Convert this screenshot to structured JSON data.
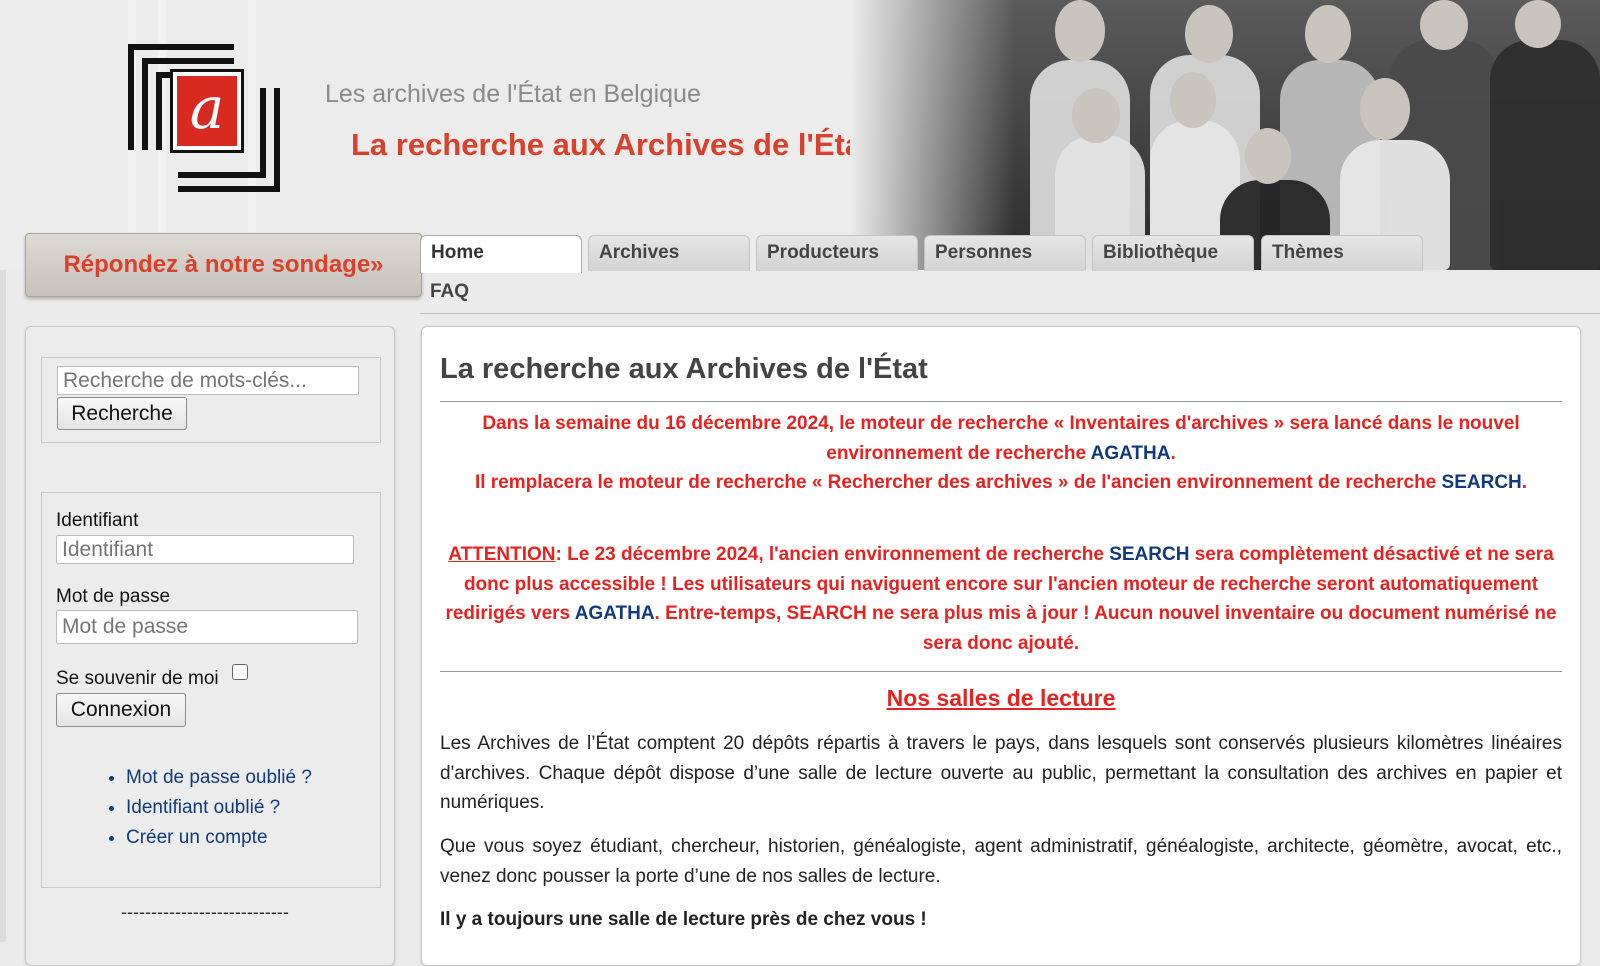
{
  "header": {
    "subtitle": "Les archives de l'État en Belgique",
    "title": "La recherche aux Archives de l'État",
    "logo_letter": "a"
  },
  "survey": {
    "label": "Répondez à notre sondage»"
  },
  "tabs": [
    {
      "label": "Home",
      "active": true
    },
    {
      "label": "Archives"
    },
    {
      "label": "Producteurs"
    },
    {
      "label": "Personnes"
    },
    {
      "label": "Bibliothèque"
    },
    {
      "label": "Thèmes"
    },
    {
      "label": "FAQ"
    }
  ],
  "search": {
    "placeholder": "Recherche de mots-clés...",
    "button": "Recherche"
  },
  "login": {
    "username_label": "Identifiant",
    "username_placeholder": "Identifiant",
    "password_label": "Mot de passe",
    "password_placeholder": "Mot de passe",
    "remember_label": "Se souvenir de moi",
    "submit": "Connexion",
    "links": [
      "Mot de passe oublié ?",
      "Identifiant oublié ?",
      "Créer un compte"
    ],
    "separator": "----------------------------"
  },
  "main": {
    "title": "La recherche aux Archives de l'État",
    "notice1": {
      "part1": "Dans la semaine du 16 décembre 2024, le moteur de recherche « Inventaires d'archives » sera lancé dans le nouvel environnement de recherche ",
      "agatha": "AGATHA",
      "part2": ".",
      "part3": "Il remplacera le moteur de recherche « Rechercher des archives » de l'ancien environnement de recherche ",
      "search": "SEARCH",
      "part4": "."
    },
    "notice2": {
      "attention": "ATTENTION",
      "part1": ": Le 23 décembre 2024, l'ancien environnement de recherche ",
      "search": "SEARCH",
      "part2": " sera complètement désactivé et ne sera donc plus accessible ! Les utilisateurs qui naviguent encore sur l'ancien moteur de recherche seront automatiquement redirigés vers ",
      "agatha": "AGATHA",
      "part3": ". Entre-temps, SEARCH ne sera plus mis à jour ! Aucun nouvel inventaire ou document numérisé ne sera donc ajouté."
    },
    "section_title": "Nos salles de lecture",
    "para1": "Les Archives de l’État comptent 20 dépôts répartis à travers le pays, dans lesquels sont conservés plusieurs kilomètres linéaires d'archives. Chaque dépôt dispose d’une salle de lecture ouverte au public, permettant la consultation des archives en papier et numériques.",
    "para2": "Que vous soyez étudiant, chercheur, historien, généalogiste, agent administratif, généalogiste, architecte, géomètre, avocat, etc., venez donc pousser la porte d’une de nos salles de lecture.",
    "para3": "Il y a toujours une salle de lecture près de chez vous !"
  },
  "colors": {
    "accent_red": "#d8412b",
    "alert_red": "#e82121",
    "link_blue": "#123a7a"
  }
}
